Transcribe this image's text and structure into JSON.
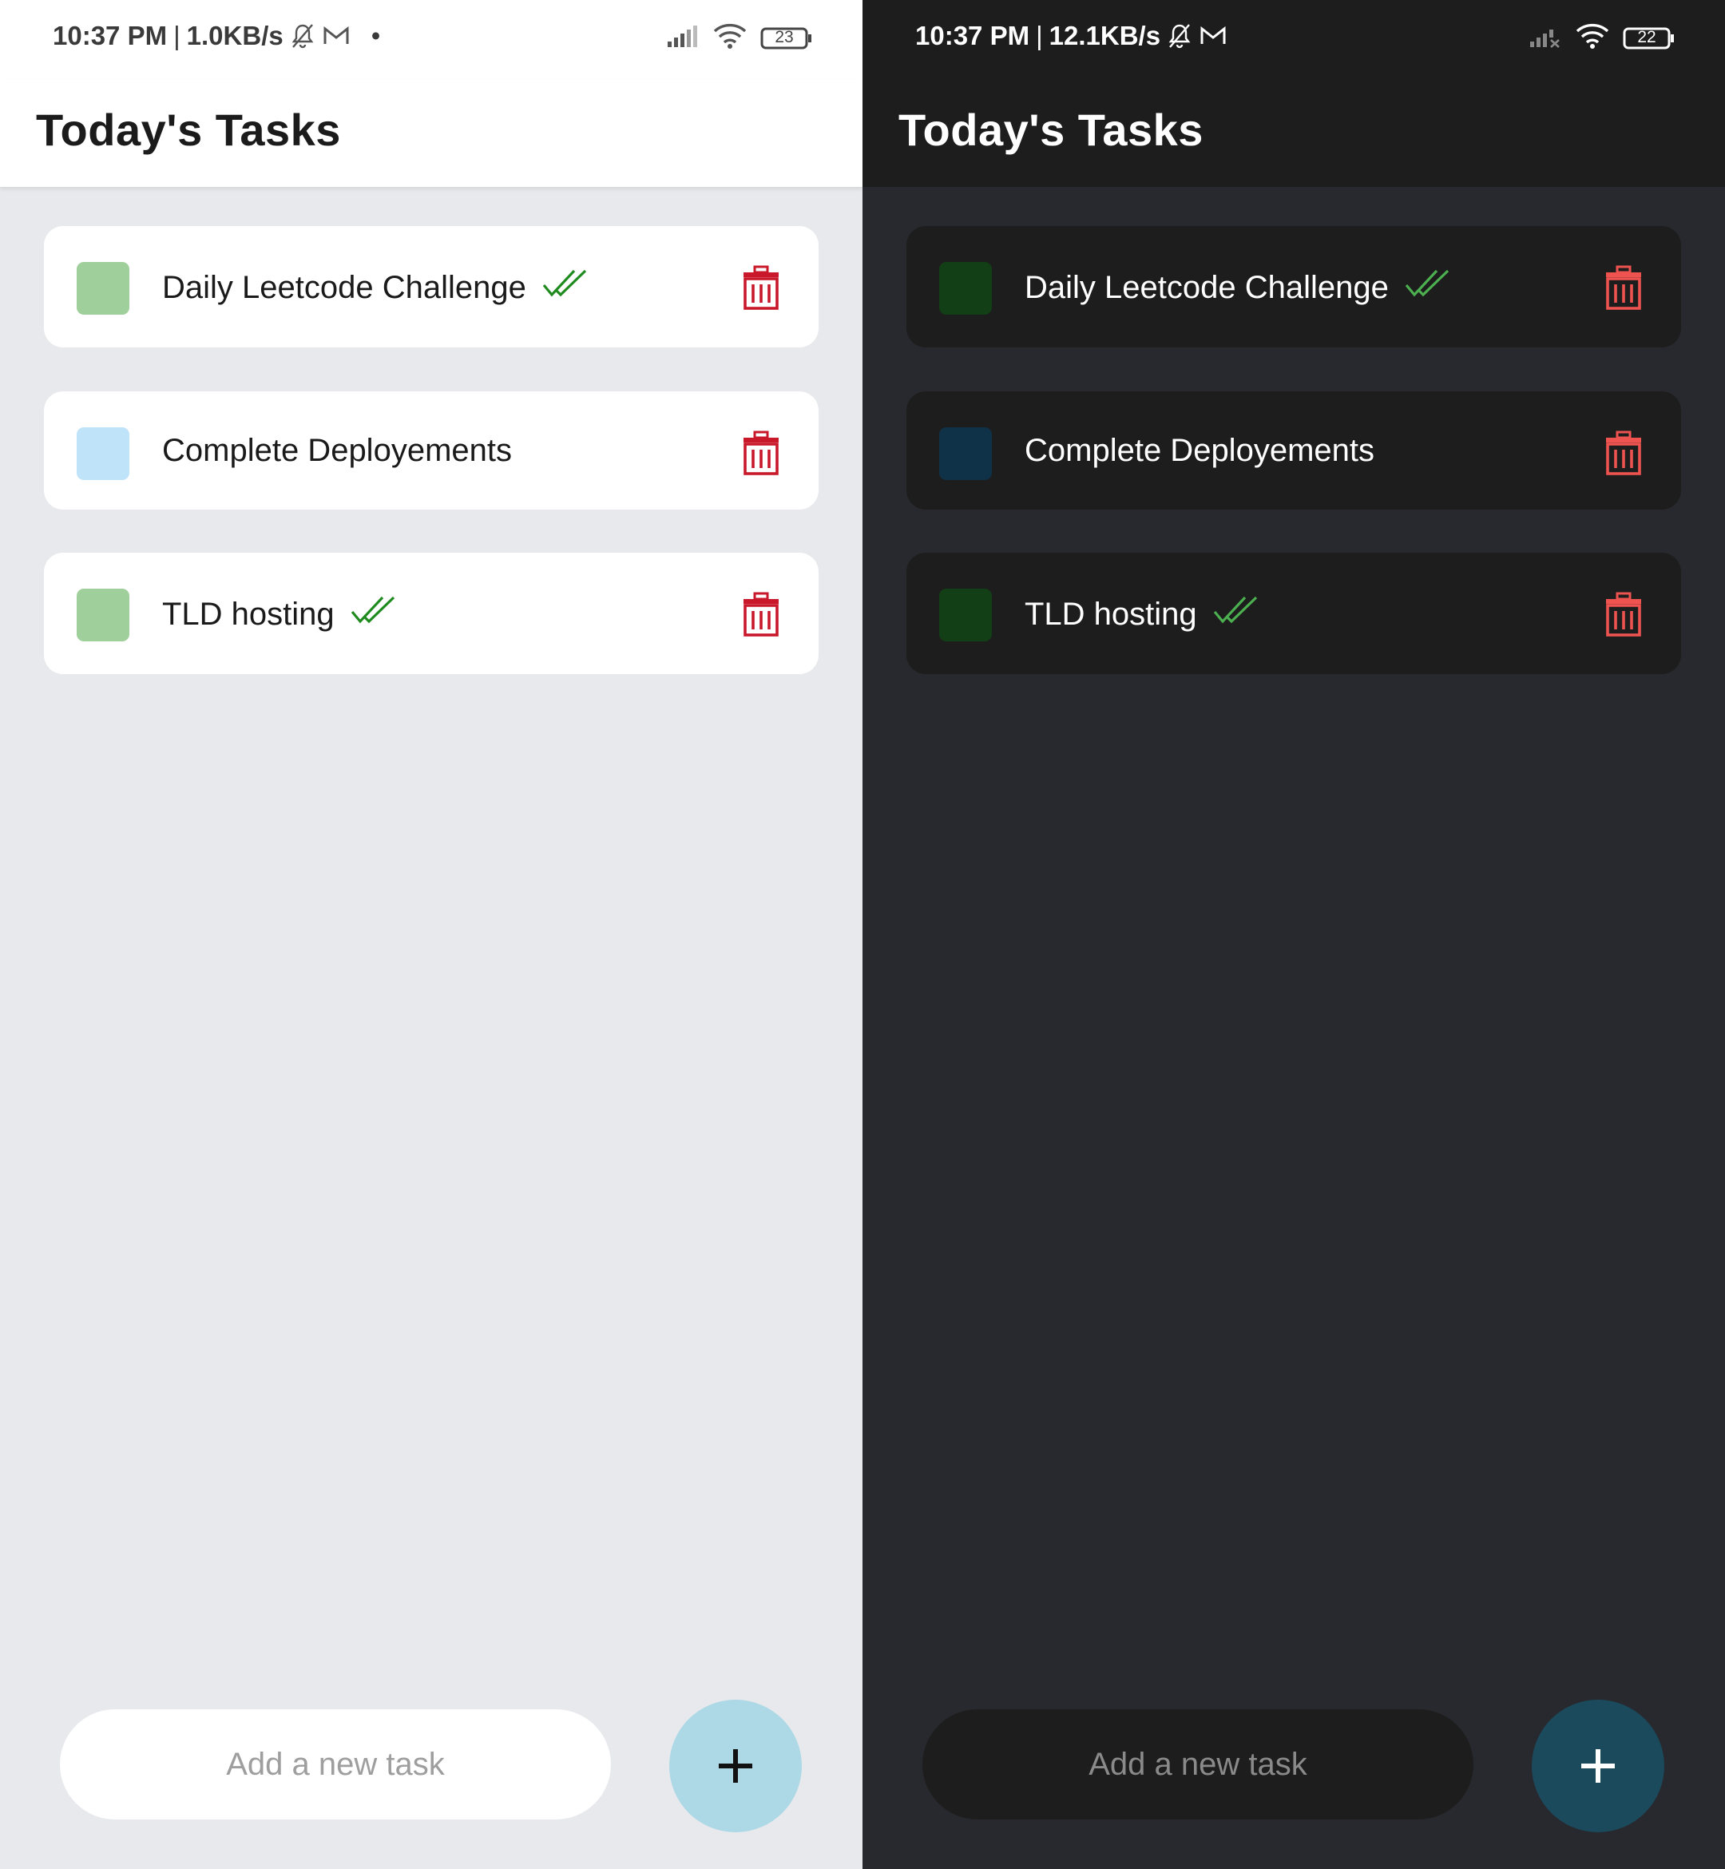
{
  "panels": [
    {
      "theme": "light",
      "status": {
        "time": "10:37 PM",
        "speed": "1.0KB/s",
        "battery": "23",
        "extra_dot": "•"
      },
      "title": "Today's Tasks",
      "tasks": [
        {
          "label": "Daily Leetcode Challenge",
          "done": true,
          "swatch": "#9fcf9a"
        },
        {
          "label": "Complete Deployements",
          "done": false,
          "swatch": "#bfe3f8"
        },
        {
          "label": "TLD hosting",
          "done": true,
          "swatch": "#9fcf9a"
        }
      ],
      "input_placeholder": "Add a new task",
      "fab_label": "+",
      "colors": {
        "check": "#1f8b1f",
        "trash": "#c8182a",
        "fab_plus": "#111111"
      }
    },
    {
      "theme": "dark",
      "status": {
        "time": "10:37 PM",
        "speed": "12.1KB/s",
        "battery": "22"
      },
      "title": "Today's Tasks",
      "tasks": [
        {
          "label": "Daily Leetcode Challenge",
          "done": true,
          "swatch": "#123f16"
        },
        {
          "label": "Complete Deployements",
          "done": false,
          "swatch": "#0f3248"
        },
        {
          "label": "TLD hosting",
          "done": true,
          "swatch": "#123f16"
        }
      ],
      "input_placeholder": "Add a new task",
      "fab_label": "+",
      "colors": {
        "check": "#4caf50",
        "trash": "#ef5350",
        "fab_plus": "#ffffff"
      }
    }
  ]
}
